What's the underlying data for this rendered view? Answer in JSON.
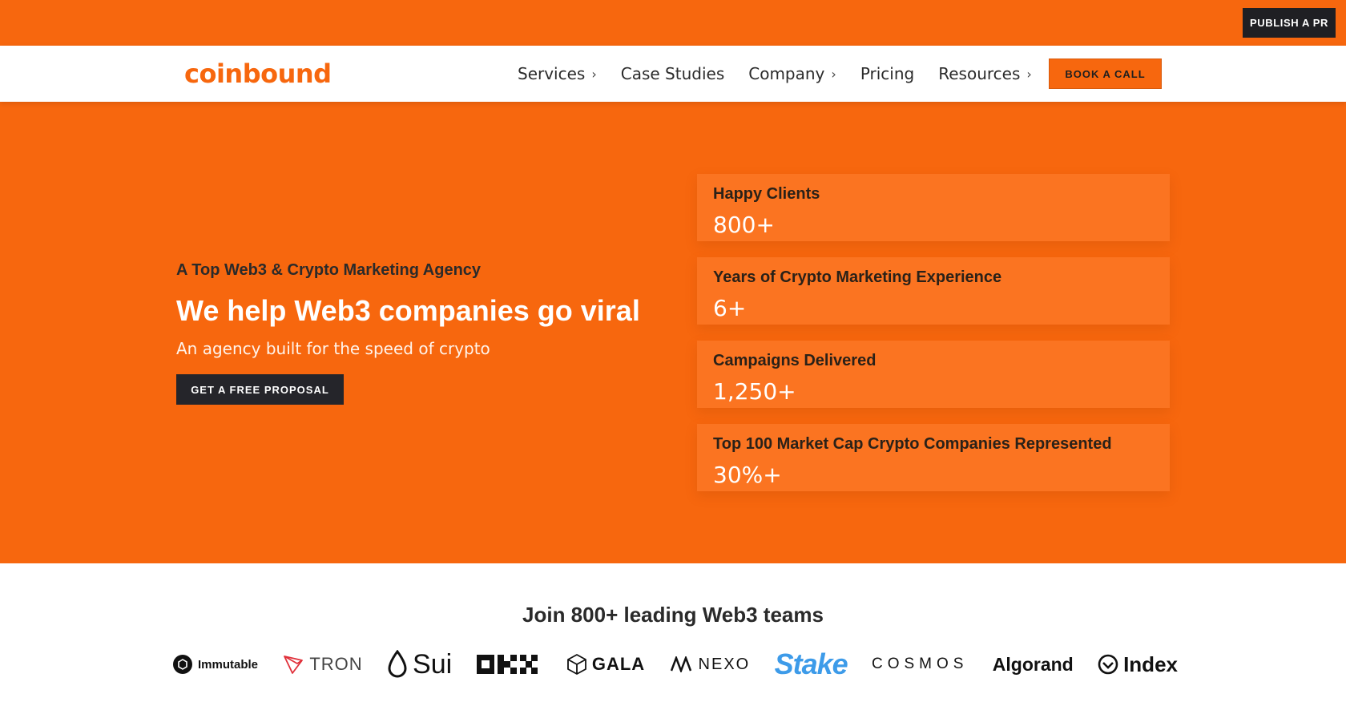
{
  "topbar": {
    "publish_label": "PUBLISH A PR"
  },
  "nav": {
    "logo": "coinbound",
    "items": [
      {
        "label": "Services",
        "has_submenu": true
      },
      {
        "label": "Case Studies",
        "has_submenu": false
      },
      {
        "label": "Company",
        "has_submenu": true
      },
      {
        "label": "Pricing",
        "has_submenu": false
      },
      {
        "label": "Resources",
        "has_submenu": true
      }
    ],
    "cta": "BOOK A CALL"
  },
  "hero": {
    "eyebrow": "A Top Web3 & Crypto Marketing Agency",
    "headline": "We help Web3 companies go viral",
    "subhead": "An agency built for the speed of crypto",
    "cta": "GET A FREE PROPOSAL",
    "stats": [
      {
        "label": "Happy Clients",
        "value": "800+"
      },
      {
        "label": "Years of Crypto Marketing Experience",
        "value": "6+"
      },
      {
        "label": "Campaigns Delivered",
        "value": "1,250+"
      },
      {
        "label": "Top 100 Market Cap Crypto Companies Represented",
        "value": "30%+"
      }
    ]
  },
  "clients": {
    "title": "Join 800+ leading Web3 teams",
    "logos": [
      "Immutable",
      "TRON",
      "Sui",
      "OKX",
      "GALA",
      "NEXO",
      "Stake",
      "COSMOS",
      "Algorand",
      "Index"
    ]
  },
  "colors": {
    "brand_orange": "#f7670e",
    "dark": "#25252a",
    "stake_blue": "#3d9be9"
  }
}
